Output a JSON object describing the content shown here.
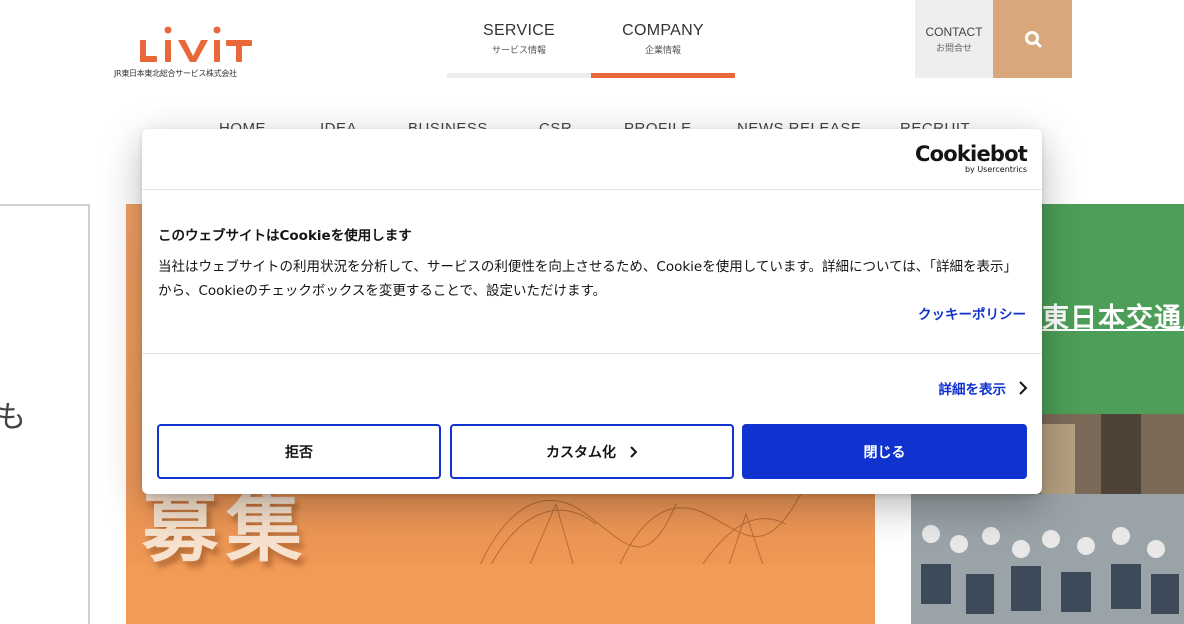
{
  "brand": {
    "logo_text": "LiViT",
    "logo_subtitle": "JR東日本東北総合サービス株式会社",
    "logo_color": "#e9683a"
  },
  "topnav": {
    "items": [
      {
        "en": "SERVICE",
        "jp": "サービス情報",
        "active": false
      },
      {
        "en": "COMPANY",
        "jp": "企業情報",
        "active": true
      }
    ],
    "active_color": "#e9683a"
  },
  "contact": {
    "en": "CONTACT",
    "jp": "お問合せ"
  },
  "search": {
    "icon": "search-icon",
    "color": "#d9a77c"
  },
  "mainnav": {
    "items": [
      "HOME",
      "IDEA",
      "BUSINESS",
      "CSR",
      "PROFILE",
      "NEWS RELEASE",
      "RECRUIT"
    ]
  },
  "background": {
    "left_glyph": "も",
    "hero_text": "募集",
    "side_title": "東日本交通広"
  },
  "cookie": {
    "brand_main": "Cookiebot",
    "brand_by": "by Usercentrics",
    "title": "このウェブサイトはCookieを使用します",
    "description": "当社はウェブサイトの利用状況を分析して、サービスの利便性を向上させるため、Cookieを使用しています。詳細については、「詳細を表示」から、Cookieのチェックボックスを変更することで、設定いただけます。",
    "policy_link": "クッキーポリシー",
    "details_link": "詳細を表示",
    "buttons": {
      "deny": "拒否",
      "customize": "カスタム化",
      "close": "閉じる"
    },
    "accent_color": "#1032cf"
  }
}
